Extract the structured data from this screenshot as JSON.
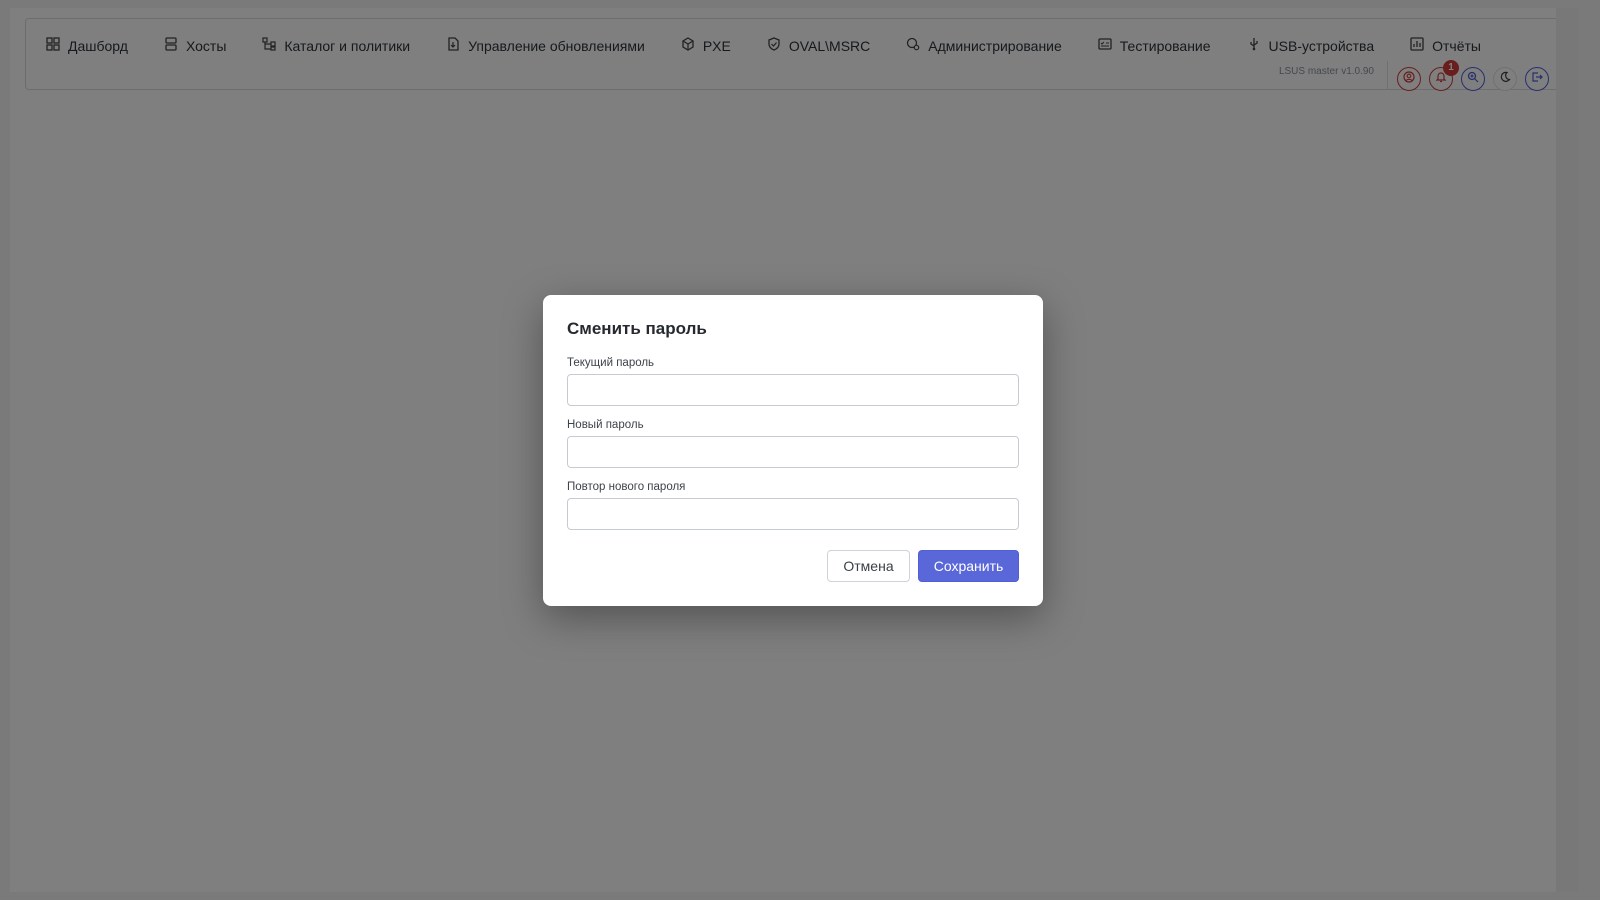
{
  "navbar": {
    "items": [
      {
        "label": "Дашборд",
        "icon": "dashboard-icon"
      },
      {
        "label": "Хосты",
        "icon": "server-icon"
      },
      {
        "label": "Каталог и политики",
        "icon": "hierarchy-icon"
      },
      {
        "label": "Управление обновлениями",
        "icon": "update-file-icon"
      },
      {
        "label": "PXE",
        "icon": "package-icon"
      },
      {
        "label": "OVAL\\MSRC",
        "icon": "shield-check-icon"
      },
      {
        "label": "Администрирование",
        "icon": "user-gear-icon"
      },
      {
        "label": "Тестирование",
        "icon": "test-checklist-icon"
      },
      {
        "label": "USB-устройства",
        "icon": "usb-icon"
      },
      {
        "label": "Отчёты",
        "icon": "report-chart-icon"
      }
    ],
    "version": "LSUS master v1.0.90",
    "notifications_count": "1",
    "actions": [
      "user-circle-icon",
      "bell-icon",
      "search-zoom-icon",
      "moon-icon",
      "logout-icon"
    ],
    "colors": {
      "user": "#d23b3b",
      "bell": "#d23b3b",
      "search": "#4f5fd9",
      "moon": "#3a3f46",
      "logout": "#4f5fd9"
    }
  },
  "modal": {
    "title": "Сменить пароль",
    "fields": [
      {
        "label": "Текущий пароль",
        "value": ""
      },
      {
        "label": "Новый пароль",
        "value": ""
      },
      {
        "label": "Повтор нового пароля",
        "value": ""
      }
    ],
    "cancel_label": "Отмена",
    "save_label": "Сохранить",
    "accent_color": "#5a67d8"
  }
}
